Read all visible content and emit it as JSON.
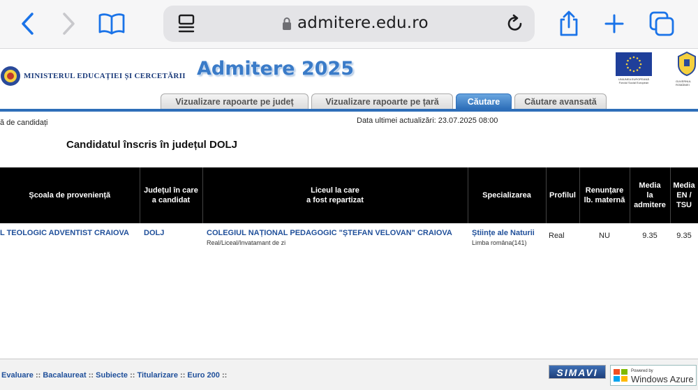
{
  "browser": {
    "url": "admitere.edu.ro"
  },
  "header": {
    "ministry": "MINISTERUL EDUCAȚIEI ȘI CERCETĂRII",
    "title": "Admitere 2025",
    "eu_text_1": "UNIUNEA EUROPEANĂ",
    "eu_text_2": "Fondul Social European",
    "gov_text": "GUVERNUL ROMÂNIEI"
  },
  "tabs": [
    {
      "label": "Vizualizare rapoarte pe județ"
    },
    {
      "label": "Vizualizare rapoarte pe țară"
    },
    {
      "label": "Căutare"
    },
    {
      "label": "Căutare avansată"
    }
  ],
  "meta": {
    "left": "ă de candidați",
    "last_update": "Data ultimei actualizări: 23.07.2025 08:00"
  },
  "page_heading": "Candidatul înscris în județul DOLJ",
  "table": {
    "headers": {
      "school": "Școala de proveniență",
      "county_1": "Județul în care",
      "county_2": "a candidat",
      "lyceum_1": "Liceul la care",
      "lyceum_2": "a fost repartizat",
      "spec": "Specializarea",
      "profile": "Profilul",
      "waiver_1": "Renunțare",
      "waiver_2": "lb. maternă",
      "avg_1": "Media",
      "avg_2": "la",
      "avg_3": "admitere",
      "en_1": "Media",
      "en_2": "EN /",
      "en_3": "TSU"
    },
    "row": {
      "school": "L TEOLOGIC ADVENTIST CRAIOVA",
      "county": "DOLJ",
      "lyceum": "COLEGIUL NAȚIONAL PEDAGOGIC \"ȘTEFAN VELOVAN\" CRAIOVA",
      "lyceum_sub": "Real/Liceal/Invatamant de zi",
      "spec": "Științe ale Naturii",
      "spec_sub": "Limba româna(141)",
      "profile": "Real",
      "waiver": "NU",
      "avg": "9.35",
      "en": "9.35"
    }
  },
  "footer": {
    "links": [
      "Evaluare",
      "Bacalaureat",
      "Subiecte",
      "Titularizare",
      "Euro 200"
    ],
    "sep": "::",
    "simavi": "SIMAVI",
    "azure_small": "Powered by",
    "azure": "Windows Azure"
  }
}
